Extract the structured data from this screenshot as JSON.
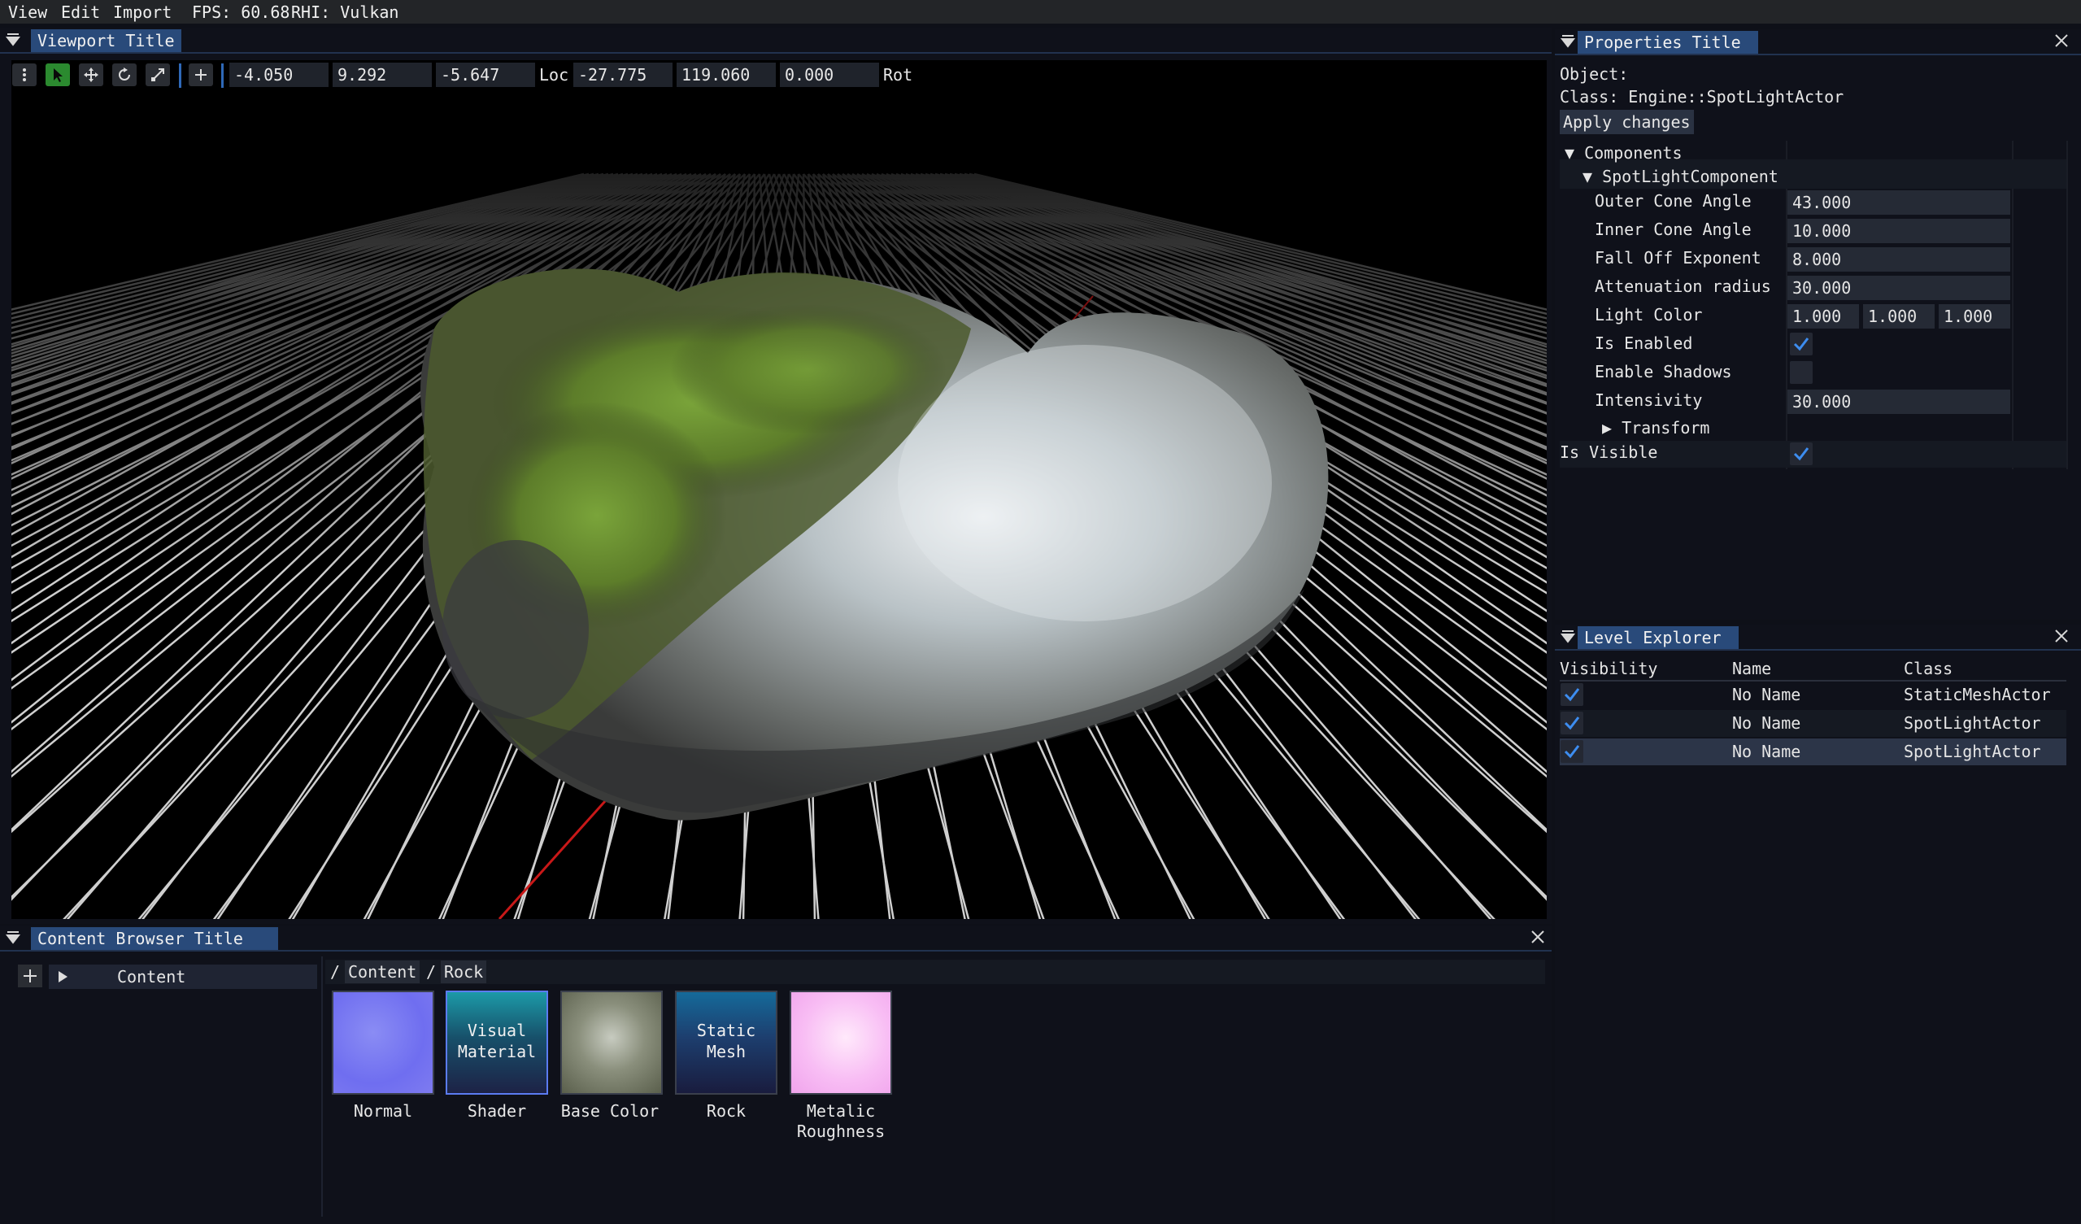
{
  "menu": {
    "view": "View",
    "edit": "Edit",
    "import": "Import",
    "fps": "FPS: 60.68",
    "rhi": "RHI: Vulkan"
  },
  "viewport": {
    "title": "Viewport Title",
    "location": {
      "x": "-4.050",
      "y": "9.292",
      "z": "-5.647",
      "label": "Loc"
    },
    "rotation": {
      "x": "-27.775",
      "y": "119.060",
      "z": "0.000",
      "label": "Rot"
    },
    "tools": [
      "menu-dots-icon",
      "select-arrow-icon",
      "move-icon",
      "rotate-icon",
      "scale-icon",
      "add-icon"
    ],
    "active_tool": "select-arrow-icon",
    "colors": {
      "accent": "#2f69b8",
      "active_tool": "#2b8a2f",
      "grid": "#d0d0d0",
      "axis": "#c81818"
    }
  },
  "properties": {
    "title": "Properties Title",
    "object_label": "Object:",
    "class_label": "Class: Engine::SpotLightActor",
    "apply_button": "Apply changes",
    "components_label": "Components",
    "component_name": "SpotLightComponent",
    "rows": {
      "outer_cone": {
        "label": "Outer Cone Angle",
        "value": "43.000"
      },
      "inner_cone": {
        "label": "Inner Cone Angle",
        "value": "10.000"
      },
      "falloff": {
        "label": "Fall Off Exponent",
        "value": "8.000"
      },
      "attenuation": {
        "label": "Attenuation radius",
        "value": "30.000"
      },
      "light_color": {
        "label": "Light Color",
        "r": "1.000",
        "g": "1.000",
        "b": "1.000"
      },
      "is_enabled": {
        "label": "Is Enabled",
        "checked": true
      },
      "enable_shadows": {
        "label": "Enable Shadows",
        "checked": false
      },
      "intensity": {
        "label": "Intensivity",
        "value": "30.000"
      }
    },
    "transform_label": "Transform",
    "is_visible": {
      "label": "Is Visible",
      "checked": true
    }
  },
  "level_explorer": {
    "title": "Level Explorer",
    "columns": [
      "Visibility",
      "Name",
      "Class"
    ],
    "rows": [
      {
        "visible": true,
        "name": "No Name",
        "class": "StaticMeshActor"
      },
      {
        "visible": true,
        "name": "No Name",
        "class": "SpotLightActor"
      },
      {
        "visible": true,
        "name": "No Name",
        "class": "SpotLightActor",
        "selected": true
      }
    ]
  },
  "content_browser": {
    "title": "Content Browser Title",
    "tree_root": "Content",
    "breadcrumb": {
      "sep1": "/",
      "content": "Content",
      "sep2": "/",
      "rock": "Rock"
    },
    "items": [
      {
        "label": "Normal",
        "thumb_text": "",
        "kind": "normal-map-thumbnail"
      },
      {
        "label": "Shader",
        "thumb_text": "Visual\nMaterial",
        "kind": "shader-thumbnail",
        "selected": true
      },
      {
        "label": "Base Color",
        "thumb_text": "",
        "kind": "texture-thumbnail"
      },
      {
        "label": "Rock",
        "thumb_text": "Static\nMesh",
        "kind": "mesh-thumbnail"
      },
      {
        "label": "Metalic\nRoughness",
        "thumb_text": "",
        "kind": "roughness-thumbnail"
      }
    ]
  }
}
